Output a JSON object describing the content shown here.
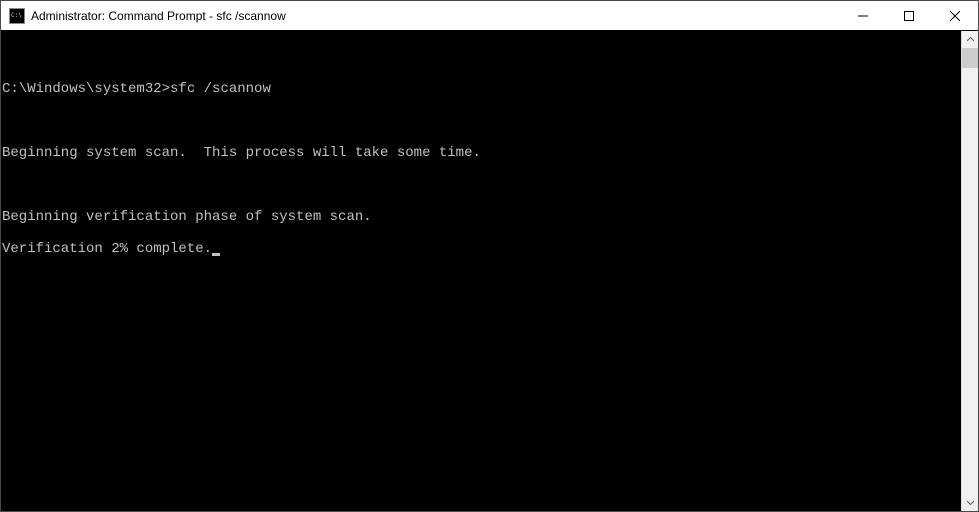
{
  "window": {
    "title": "Administrator: Command Prompt - sfc  /scannow"
  },
  "terminal": {
    "prompt": "C:\\Windows\\system32>",
    "command": "sfc /scannow",
    "lines": {
      "blank": "",
      "begin_scan": "Beginning system scan.  This process will take some time.",
      "begin_verify": "Beginning verification phase of system scan.",
      "progress": "Verification 2% complete."
    }
  }
}
